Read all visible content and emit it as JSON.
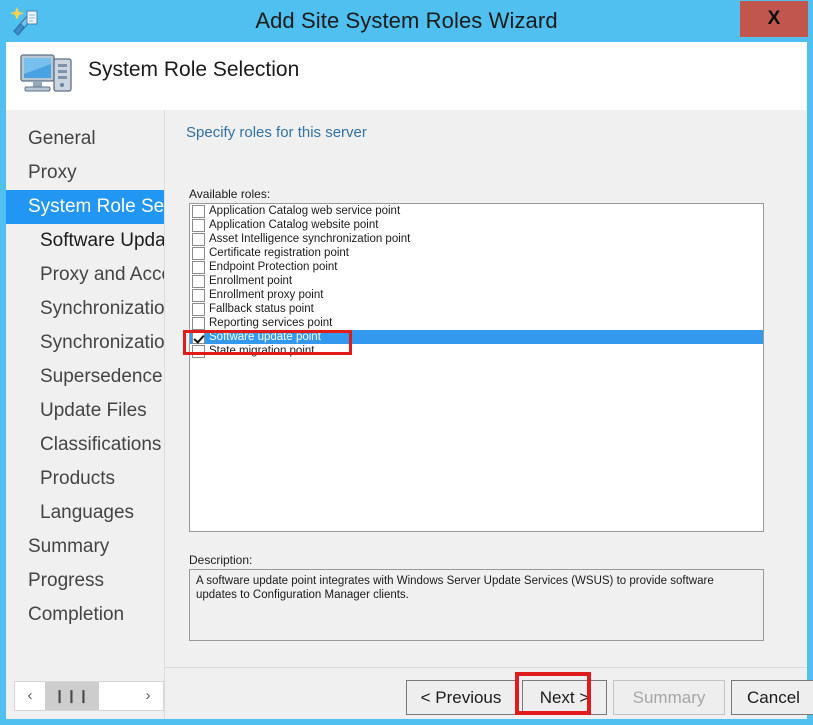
{
  "window": {
    "title": "Add Site System Roles Wizard",
    "close_label": "X",
    "close_color": "#c0564c",
    "titlebar_color": "#4fc0ef",
    "wizard_icon": "wizard-wand-icon"
  },
  "header": {
    "title": "System Role Selection",
    "icon": "computer-icon"
  },
  "sidebar": {
    "items": [
      {
        "label": "General",
        "level": 0,
        "state": "normal"
      },
      {
        "label": "Proxy",
        "level": 0,
        "state": "normal"
      },
      {
        "label": "System Role Selection",
        "level": 0,
        "state": "active"
      },
      {
        "label": "Software Update Point",
        "level": 1,
        "state": "bold"
      },
      {
        "label": "Proxy and Account Settings",
        "level": 1,
        "state": "normal"
      },
      {
        "label": "Synchronization Source",
        "level": 1,
        "state": "normal"
      },
      {
        "label": "Synchronization Schedule",
        "level": 1,
        "state": "normal"
      },
      {
        "label": "Supersedence Rules",
        "level": 1,
        "state": "normal"
      },
      {
        "label": "Update Files",
        "level": 1,
        "state": "normal"
      },
      {
        "label": "Classifications",
        "level": 1,
        "state": "normal"
      },
      {
        "label": "Products",
        "level": 1,
        "state": "normal"
      },
      {
        "label": "Languages",
        "level": 1,
        "state": "normal"
      },
      {
        "label": "Summary",
        "level": 0,
        "state": "normal"
      },
      {
        "label": "Progress",
        "level": 0,
        "state": "normal"
      },
      {
        "label": "Completion",
        "level": 0,
        "state": "normal"
      }
    ],
    "scroll": {
      "left_arrow": "‹",
      "right_arrow": "›",
      "thumb_glyph": "❙❙❙"
    }
  },
  "main": {
    "instruction": "Specify roles for this server",
    "available_roles_label": "Available roles:",
    "description_label": "Description:",
    "description_text": "A software update point integrates with Windows Server Update Services (WSUS) to provide software updates to Configuration Manager clients.",
    "selection_color": "#3399ef",
    "annotation_color": "#e01b1b",
    "roles": [
      {
        "label": "Application Catalog web service point",
        "checked": false,
        "selected": false
      },
      {
        "label": "Application Catalog website point",
        "checked": false,
        "selected": false
      },
      {
        "label": "Asset Intelligence synchronization point",
        "checked": false,
        "selected": false
      },
      {
        "label": "Certificate registration point",
        "checked": false,
        "selected": false
      },
      {
        "label": "Endpoint Protection point",
        "checked": false,
        "selected": false
      },
      {
        "label": "Enrollment point",
        "checked": false,
        "selected": false
      },
      {
        "label": "Enrollment proxy point",
        "checked": false,
        "selected": false
      },
      {
        "label": "Fallback status point",
        "checked": false,
        "selected": false
      },
      {
        "label": "Reporting services point",
        "checked": false,
        "selected": false
      },
      {
        "label": "Software update point",
        "checked": true,
        "selected": true
      },
      {
        "label": "State migration point",
        "checked": false,
        "selected": false
      }
    ]
  },
  "footer": {
    "previous_label": "< Previous",
    "next_label": "Next >",
    "summary_label": "Summary",
    "cancel_label": "Cancel",
    "summary_disabled": true
  }
}
